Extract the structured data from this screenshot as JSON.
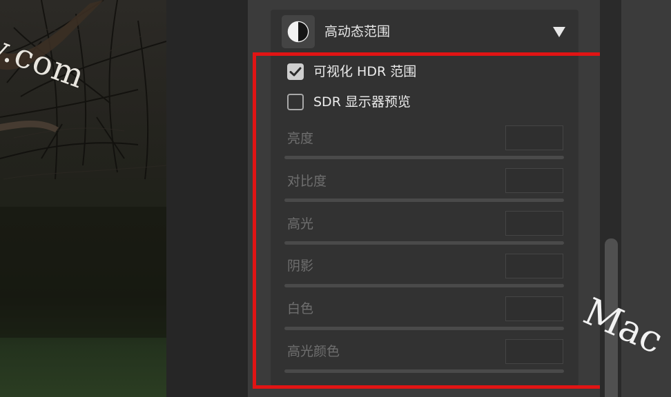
{
  "watermarks": {
    "left": "v.com",
    "right": "Mac"
  },
  "section": {
    "title": "高动态范围",
    "icon": "half-circle-contrast-icon",
    "collapse_icon": "triangle-down-icon"
  },
  "options": [
    {
      "label": "可视化 HDR 范围",
      "checked": true
    },
    {
      "label": "SDR 显示器预览",
      "checked": false
    }
  ],
  "sliders": [
    {
      "label": "亮度",
      "value": ""
    },
    {
      "label": "对比度",
      "value": ""
    },
    {
      "label": "高光",
      "value": ""
    },
    {
      "label": "阴影",
      "value": ""
    },
    {
      "label": "白色",
      "value": ""
    },
    {
      "label": "高光颜色",
      "value": ""
    }
  ],
  "colors": {
    "highlight": "#e11414",
    "panel_bg": "#3b3b3b",
    "section_bg": "#323232"
  }
}
